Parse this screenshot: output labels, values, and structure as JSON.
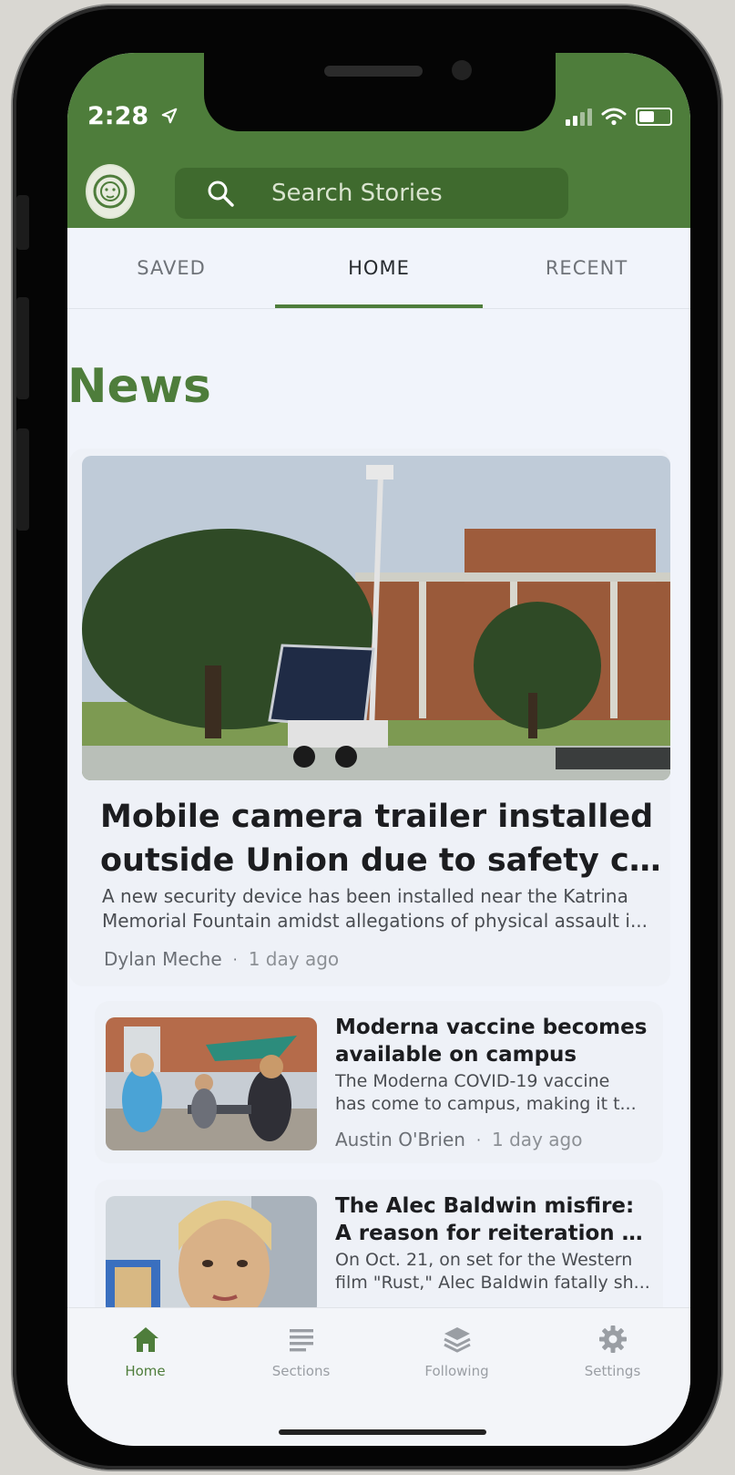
{
  "status_bar": {
    "time": "2:28",
    "icons": [
      "location-arrow-icon",
      "cellular-signal-icon",
      "wifi-icon",
      "battery-icon"
    ]
  },
  "header": {
    "logo_icon": "lion-logo-icon",
    "search_placeholder": "Search Stories",
    "brand_color": "#4e7d3b"
  },
  "tabs": [
    {
      "label": "SAVED",
      "active": false
    },
    {
      "label": "HOME",
      "active": true
    },
    {
      "label": "RECENT",
      "active": false
    }
  ],
  "section_title": "News",
  "featured": {
    "title_line1": "Mobile camera trailer installed",
    "title_line2": "outside Union due to safety c...",
    "desc_line1": "A new security device has been installed near the Katrina",
    "desc_line2": "Memorial Fountain amidst allegations of physical assault i...",
    "author": "Dylan Meche",
    "time": "1 day ago",
    "separator": "·"
  },
  "stories": [
    {
      "title_line1": "Moderna vaccine becomes",
      "title_line2": "available on campus",
      "desc_line1": "The Moderna COVID-19 vaccine",
      "desc_line2": "has come to campus, making it t...",
      "author": "Austin O'Brien",
      "time": "1 day ago",
      "separator": "·"
    },
    {
      "title_line1": "The Alec Baldwin misfire:",
      "title_line2": "A reason for reiteration of...",
      "desc_line1": "On Oct. 21, on set for the Western",
      "desc_line2": "film \"Rust,\" Alec Baldwin fatally sh..."
    }
  ],
  "bottom_nav": [
    {
      "label": "Home",
      "icon": "home-icon",
      "active": true
    },
    {
      "label": "Sections",
      "icon": "sections-icon",
      "active": false
    },
    {
      "label": "Following",
      "icon": "layers-icon",
      "active": false
    },
    {
      "label": "Settings",
      "icon": "gear-icon",
      "active": false
    }
  ]
}
